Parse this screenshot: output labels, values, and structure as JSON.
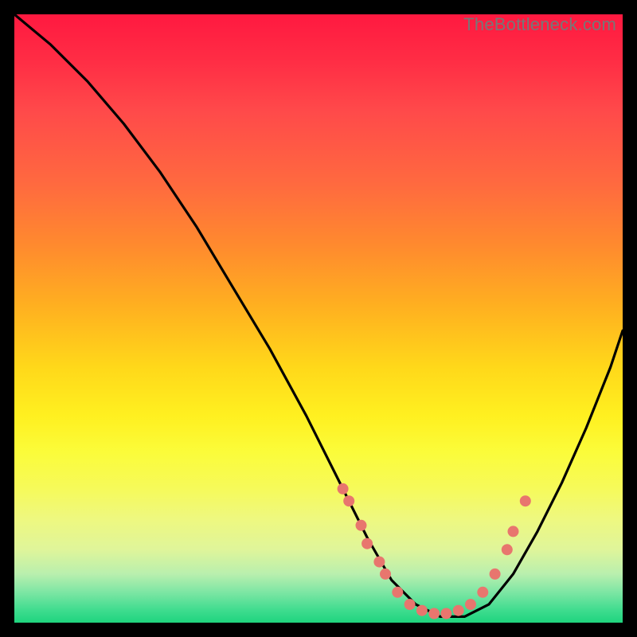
{
  "watermark": "TheBottleneck.com",
  "chart_data": {
    "type": "line",
    "title": "",
    "xlabel": "",
    "ylabel": "",
    "xlim": [
      0,
      100
    ],
    "ylim": [
      0,
      100
    ],
    "grid": false,
    "legend": false,
    "series": [
      {
        "name": "bottleneck-curve",
        "x": [
          0,
          6,
          12,
          18,
          24,
          30,
          36,
          42,
          48,
          54,
          58,
          62,
          66,
          70,
          74,
          78,
          82,
          86,
          90,
          94,
          98,
          100
        ],
        "y": [
          100,
          95,
          89,
          82,
          74,
          65,
          55,
          45,
          34,
          22,
          14,
          7,
          3,
          1,
          1,
          3,
          8,
          15,
          23,
          32,
          42,
          48
        ]
      }
    ],
    "markers": [
      {
        "x": 54,
        "y": 22
      },
      {
        "x": 55,
        "y": 20
      },
      {
        "x": 57,
        "y": 16
      },
      {
        "x": 58,
        "y": 13
      },
      {
        "x": 60,
        "y": 10
      },
      {
        "x": 61,
        "y": 8
      },
      {
        "x": 63,
        "y": 5
      },
      {
        "x": 65,
        "y": 3
      },
      {
        "x": 67,
        "y": 2
      },
      {
        "x": 69,
        "y": 1.5
      },
      {
        "x": 71,
        "y": 1.5
      },
      {
        "x": 73,
        "y": 2
      },
      {
        "x": 75,
        "y": 3
      },
      {
        "x": 77,
        "y": 5
      },
      {
        "x": 79,
        "y": 8
      },
      {
        "x": 81,
        "y": 12
      },
      {
        "x": 82,
        "y": 15
      },
      {
        "x": 84,
        "y": 20
      }
    ],
    "marker_color": "#e8766e",
    "curve_color": "#000000"
  }
}
